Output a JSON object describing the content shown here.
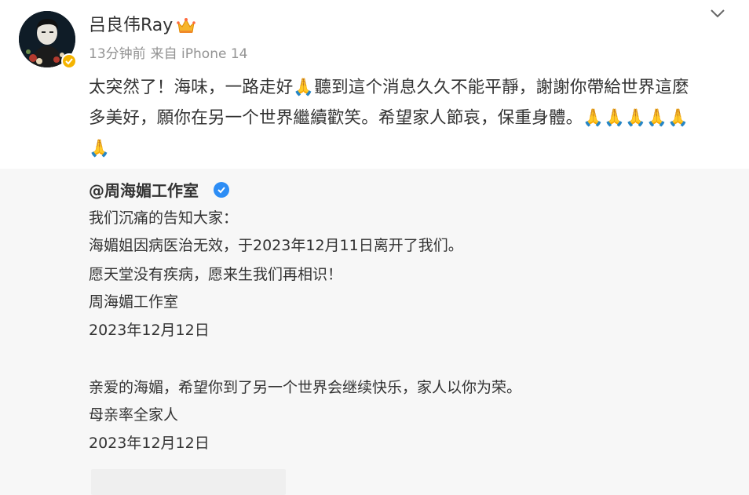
{
  "post": {
    "author_name": "吕良伟Ray",
    "meta_time": "13分钟前",
    "meta_source": "来自 iPhone 14",
    "text_lines": [
      "太突然了！海味，一路走好🙏聽到這个消息久久不能平靜，謝謝你帶給世界這麼",
      "多美好，願你在另一个世界繼續歡笑。希望家人節哀，保重身體。🙏🙏🙏🙏🙏",
      "🙏"
    ]
  },
  "repost": {
    "author_mention": "@周海媚工作室",
    "lines": [
      "我们沉痛的告知大家：",
      "海媚姐因病医治无效，于2023年12月11日离开了我们。",
      "愿天堂没有疾病，愿来生我们再相识！",
      "周海媚工作室",
      "2023年12月12日",
      "亲爱的海媚，希望你到了另一个世界会继续快乐，家人以你为荣。",
      "母亲率全家人",
      "2023年12月12日"
    ]
  },
  "icons": {
    "chevron": "chevron-down-icon",
    "crown": "crown-icon",
    "verified_gold": "verified-badge-icon",
    "verified_blue": "verified-badge-icon"
  },
  "colors": {
    "text": "#333333",
    "meta": "#939393",
    "repost_bg": "#f7f7f7",
    "gold_badge": "#f5b400",
    "blue_badge": "#2d8df5"
  }
}
